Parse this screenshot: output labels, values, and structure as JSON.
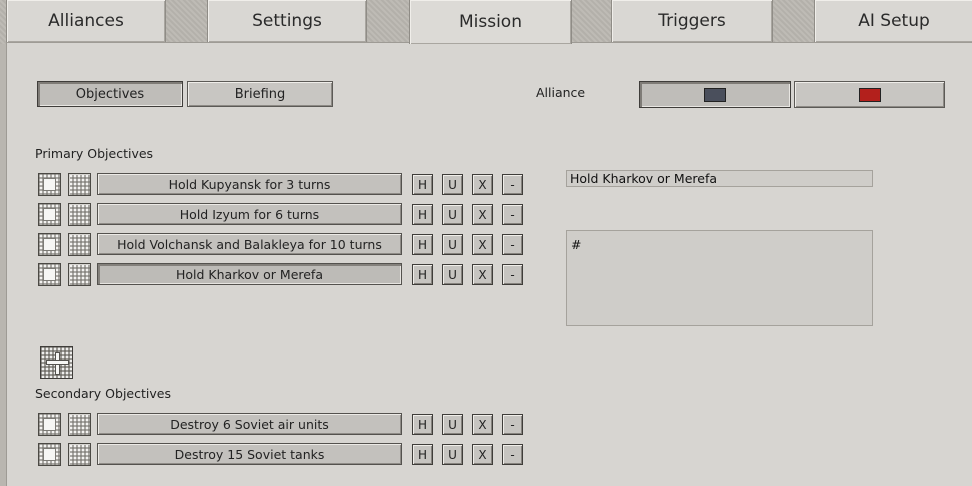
{
  "tabs": [
    "Alliances",
    "Settings",
    "Mission",
    "Triggers",
    "AI Setup"
  ],
  "subtabs": {
    "objectives": "Objectives",
    "briefing": "Briefing"
  },
  "alliance": {
    "label": "Alliance",
    "colors": [
      "#4a4f5c",
      "#b3201c"
    ]
  },
  "primary": {
    "heading": "Primary Objectives",
    "items": [
      "Hold Kupyansk for 3 turns",
      "Hold Izyum for 6 turns",
      "Hold Volchansk and Balakleya for 10 turns",
      "Hold Kharkov or Merefa"
    ]
  },
  "secondary": {
    "heading": "Secondary Objectives",
    "items": [
      "Destroy 6 Soviet air units",
      "Destroy 15 Soviet tanks"
    ]
  },
  "row_buttons": {
    "h": "H",
    "u": "U",
    "x": "X",
    "minus": "-"
  },
  "detail": {
    "title": "Hold Kharkov or Merefa",
    "text": "#"
  },
  "icons": {
    "add": "plus-icon"
  }
}
